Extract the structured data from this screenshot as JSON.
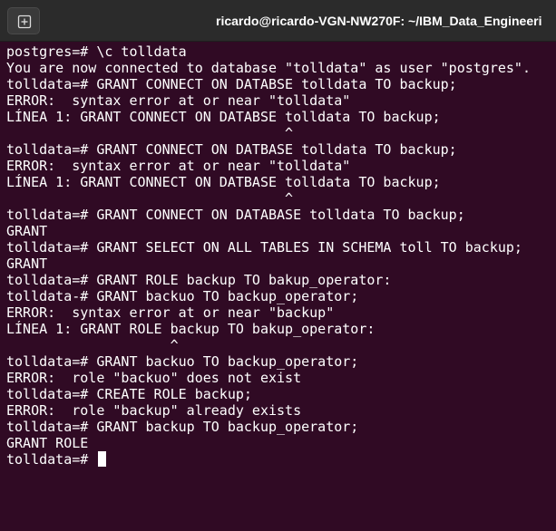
{
  "window": {
    "title": "ricardo@ricardo-VGN-NW270F: ~/IBM_Data_Engineeri",
    "new_tab_icon": "new-tab-icon"
  },
  "terminal": {
    "lines": [
      "postgres=# \\c tolldata",
      "You are now connected to database \"tolldata\" as user \"postgres\".",
      "tolldata=# GRANT CONNECT ON DATABSE tolldata TO backup;",
      "ERROR:  syntax error at or near \"tolldata\"",
      "LÍNEA 1: GRANT CONNECT ON DATABSE tolldata TO backup;",
      "                                  ^",
      "tolldata=# GRANT CONNECT ON DATBASE tolldata TO backup;",
      "ERROR:  syntax error at or near \"tolldata\"",
      "LÍNEA 1: GRANT CONNECT ON DATBASE tolldata TO backup;",
      "                                  ^",
      "tolldata=# GRANT CONNECT ON DATABASE tolldata TO backup;",
      "GRANT",
      "tolldata=# GRANT SELECT ON ALL TABLES IN SCHEMA toll TO backup;",
      "GRANT",
      "tolldata=# GRANT ROLE backup TO bakup_operator:",
      "tolldata-# GRANT backuo TO backup_operator;",
      "ERROR:  syntax error at or near \"backup\"",
      "LÍNEA 1: GRANT ROLE backup TO bakup_operator:",
      "                    ^",
      "tolldata=# GRANT backuo TO backup_operator;",
      "ERROR:  role \"backuo\" does not exist",
      "tolldata=# CREATE ROLE backup;",
      "ERROR:  role \"backup\" already exists",
      "tolldata=# GRANT backup TO backup_operator;",
      "GRANT ROLE"
    ],
    "prompt": "tolldata=# "
  }
}
